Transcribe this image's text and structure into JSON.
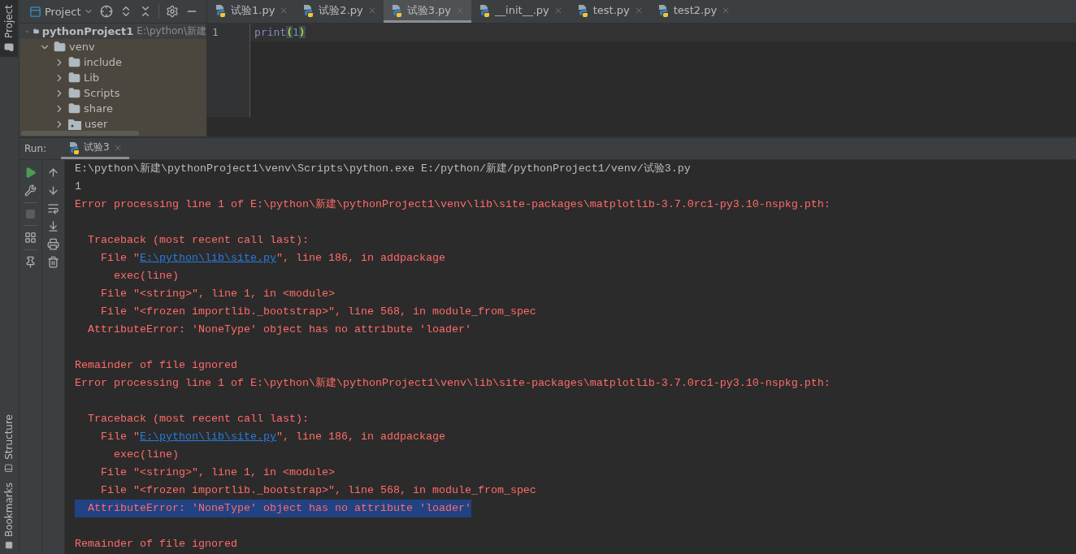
{
  "side_stripe": {
    "top": [
      {
        "label": "Project",
        "selected": true
      }
    ],
    "bottom": [
      {
        "label": "Structure",
        "selected": false
      },
      {
        "label": "Bookmarks",
        "selected": false
      }
    ]
  },
  "project_panel": {
    "view": "Project",
    "tree": [
      {
        "label": "pythonProject1",
        "path": "E:\\python\\新建",
        "kind": "folder",
        "expanded": true,
        "selected": true,
        "children": [
          {
            "label": "venv",
            "kind": "folder",
            "expanded": true,
            "selected": false,
            "children": [
              {
                "label": "include",
                "kind": "folder",
                "expanded": false,
                "selected": false
              },
              {
                "label": "Lib",
                "kind": "folder",
                "expanded": false,
                "selected": false
              },
              {
                "label": "Scripts",
                "kind": "folder",
                "expanded": false,
                "selected": false
              },
              {
                "label": "share",
                "kind": "folder",
                "expanded": false,
                "selected": false
              },
              {
                "label": "user",
                "kind": "package",
                "expanded": false,
                "selected": false
              }
            ]
          }
        ]
      }
    ]
  },
  "editor": {
    "tabs": [
      {
        "label": "试验1.py",
        "selected": false
      },
      {
        "label": "试验2.py",
        "selected": false
      },
      {
        "label": "试验3.py",
        "selected": true
      },
      {
        "label": "__init__.py",
        "selected": false
      },
      {
        "label": "test.py",
        "selected": false
      },
      {
        "label": "test2.py",
        "selected": false
      }
    ],
    "lines": [
      {
        "number": "1",
        "tokens": [
          {
            "text": "print",
            "kind": "builtin"
          },
          {
            "text": "(",
            "kind": "paren"
          },
          {
            "text": "1",
            "kind": "number"
          },
          {
            "text": ")",
            "kind": "paren"
          }
        ]
      }
    ]
  },
  "run": {
    "label": "Run:",
    "tabs": [
      {
        "label": "试验3",
        "selected": true
      }
    ],
    "console": [
      {
        "kind": "normal",
        "selected": false,
        "text": "E:\\python\\新建\\pythonProject1\\venv\\Scripts\\python.exe E:/python/新建/pythonProject1/venv/试验3.py"
      },
      {
        "kind": "normal",
        "selected": false,
        "text": "1"
      },
      {
        "kind": "error",
        "selected": false,
        "text": "Error processing line 1 of E:\\python\\新建\\pythonProject1\\venv\\lib\\site-packages\\matplotlib-3.7.0rc1-py3.10-nspkg.pth:"
      },
      {
        "kind": "blank"
      },
      {
        "kind": "error",
        "selected": false,
        "text": "  Traceback (most recent call last):"
      },
      {
        "kind": "error",
        "selected": false,
        "text": "    File \"",
        "link": "E:\\python\\lib\\site.py",
        "after": "\", line 186, in addpackage"
      },
      {
        "kind": "error",
        "selected": false,
        "text": "      exec(line)"
      },
      {
        "kind": "error",
        "selected": false,
        "text": "    File \"<string>\", line 1, in <module>"
      },
      {
        "kind": "error",
        "selected": false,
        "text": "    File \"<frozen importlib._bootstrap>\", line 568, in module_from_spec"
      },
      {
        "kind": "error",
        "selected": false,
        "text": "  AttributeError: 'NoneType' object has no attribute 'loader'"
      },
      {
        "kind": "blank"
      },
      {
        "kind": "error",
        "selected": false,
        "text": "Remainder of file ignored"
      },
      {
        "kind": "error",
        "selected": false,
        "text": "Error processing line 1 of E:\\python\\新建\\pythonProject1\\venv\\lib\\site-packages\\matplotlib-3.7.0rc1-py3.10-nspkg.pth:"
      },
      {
        "kind": "blank"
      },
      {
        "kind": "error",
        "selected": false,
        "text": "  Traceback (most recent call last):"
      },
      {
        "kind": "error",
        "selected": false,
        "text": "    File \"",
        "link": "E:\\python\\lib\\site.py",
        "after": "\", line 186, in addpackage"
      },
      {
        "kind": "error",
        "selected": false,
        "text": "      exec(line)"
      },
      {
        "kind": "error",
        "selected": false,
        "text": "    File \"<string>\", line 1, in <module>"
      },
      {
        "kind": "error",
        "selected": false,
        "text": "    File \"<frozen importlib._bootstrap>\", line 568, in module_from_spec"
      },
      {
        "kind": "error",
        "selected": true,
        "text": "  AttributeError: 'NoneType' object has no attribute 'loader'"
      },
      {
        "kind": "blank"
      },
      {
        "kind": "error",
        "selected": false,
        "text": "Remainder of file ignored"
      }
    ]
  }
}
